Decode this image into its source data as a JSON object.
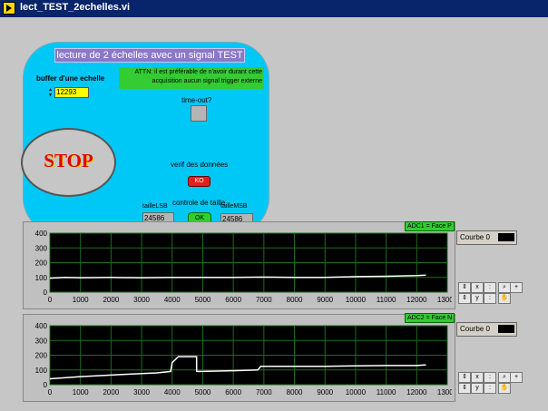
{
  "window": {
    "title": "lect_TEST_2echelles.vi"
  },
  "panel": {
    "title": "lecture de 2 échelles avec un signal TEST",
    "attn": "ATTN: il est préférable de n'avoir durant cette acquisition aucun signal trigger externe",
    "buffer_label": "buffer d'une echelle",
    "buffer_value": "12293",
    "stop_label": "STOP",
    "timeout_label": "time-out?",
    "verif_label": "verif des données",
    "verif_button": "KO",
    "controle_label": "controle de taille",
    "ok_button": "OK",
    "taille_lsb_label": "tailleLSB",
    "taille_lsb_value": "24586",
    "taille_msb_label": "tailleMSB",
    "taille_msb_value": "24586"
  },
  "graphs": [
    {
      "legend": "ADC1 = Face P",
      "courbe": "Courbe 0"
    },
    {
      "legend": "ADC2 = Face N",
      "courbe": "Courbe 0"
    }
  ],
  "chart_data": [
    {
      "type": "line",
      "title": "ADC1 = Face P",
      "xlim": [
        0,
        13000
      ],
      "ylim": [
        0,
        400
      ],
      "xticks": [
        0,
        1000,
        2000,
        3000,
        4000,
        5000,
        6000,
        7000,
        8000,
        9000,
        10000,
        11000,
        12000,
        13000
      ],
      "yticks": [
        0,
        100,
        200,
        300,
        400
      ],
      "grid": true,
      "series": [
        {
          "name": "Courbe 0",
          "color": "#ffffff",
          "points": [
            [
              0,
              95
            ],
            [
              500,
              100
            ],
            [
              1000,
              98
            ],
            [
              2000,
              100
            ],
            [
              3000,
              98
            ],
            [
              4000,
              100
            ],
            [
              5000,
              100
            ],
            [
              6000,
              100
            ],
            [
              7000,
              102
            ],
            [
              8000,
              100
            ],
            [
              9000,
              100
            ],
            [
              10000,
              105
            ],
            [
              11000,
              108
            ],
            [
              12000,
              112
            ],
            [
              12300,
              115
            ]
          ]
        }
      ]
    },
    {
      "type": "line",
      "title": "ADC2 = Face N",
      "xlim": [
        0,
        13000
      ],
      "ylim": [
        0,
        400
      ],
      "xticks": [
        0,
        1000,
        2000,
        3000,
        4000,
        5000,
        6000,
        7000,
        8000,
        9000,
        10000,
        11000,
        12000,
        13000
      ],
      "yticks": [
        0,
        100,
        200,
        300,
        400
      ],
      "grid": true,
      "series": [
        {
          "name": "Courbe 0",
          "color": "#ffffff",
          "points": [
            [
              0,
              40
            ],
            [
              1000,
              55
            ],
            [
              2000,
              65
            ],
            [
              3000,
              75
            ],
            [
              3500,
              80
            ],
            [
              3950,
              90
            ],
            [
              4000,
              150
            ],
            [
              4100,
              170
            ],
            [
              4200,
              190
            ],
            [
              4800,
              190
            ],
            [
              4800,
              90
            ],
            [
              5000,
              90
            ],
            [
              6000,
              95
            ],
            [
              6800,
              100
            ],
            [
              6900,
              125
            ],
            [
              8000,
              125
            ],
            [
              9000,
              125
            ],
            [
              10000,
              128
            ],
            [
              11000,
              130
            ],
            [
              12000,
              130
            ],
            [
              12300,
              135
            ]
          ]
        }
      ]
    }
  ]
}
